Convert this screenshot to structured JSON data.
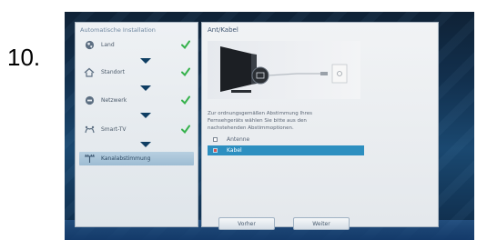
{
  "step_number": "10.",
  "left_panel": {
    "title": "Automatische Installation",
    "steps": [
      {
        "label": "Land",
        "icon": "globe-icon",
        "done": true
      },
      {
        "label": "Standort",
        "icon": "house-icon",
        "done": true
      },
      {
        "label": "Netzwerk",
        "icon": "network-icon",
        "done": true
      },
      {
        "label": "Smart-TV",
        "icon": "smart-tv-icon",
        "done": true
      },
      {
        "label": "Kanalabstimmung",
        "icon": "antenna-icon",
        "done": false,
        "active": true
      }
    ]
  },
  "right_panel": {
    "title": "Ant/Kabel",
    "description": [
      "Zur ordnungsgemäßen Abstimmung Ihres",
      "Fernsehgeräts wählen Sie bitte aus den",
      "nachstehenden Abstimmoptionen."
    ],
    "options": [
      {
        "label": "Antenne",
        "selected": false
      },
      {
        "label": "Kabel",
        "selected": true
      }
    ],
    "buttons": {
      "back": "Vorher",
      "next": "Weiter"
    }
  },
  "colors": {
    "accent": "#2d8fc0",
    "check": "#37b24d",
    "arrow": "#0f3e63"
  }
}
